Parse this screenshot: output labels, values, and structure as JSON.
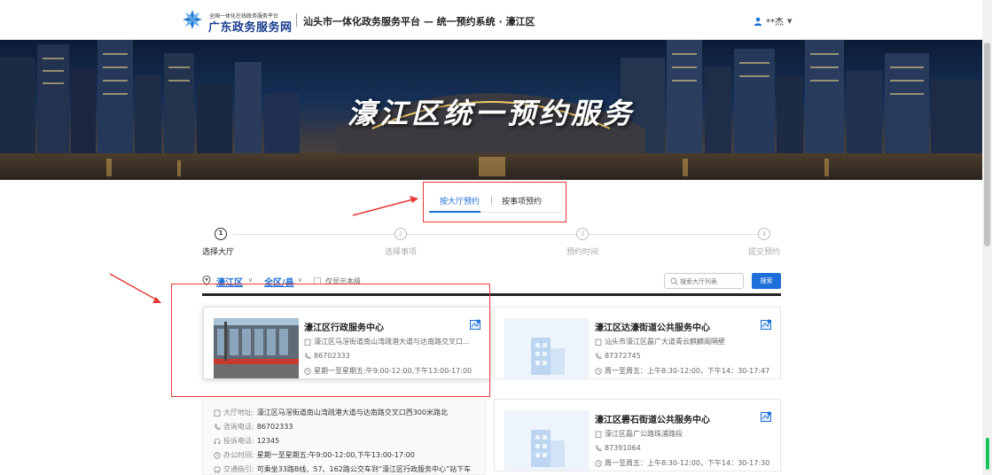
{
  "header": {
    "logo_small": "全国一体化在线政务服务平台",
    "logo_big": "广东政务服务网",
    "title": "汕头市一体化政务服务平台 — 统一预约系统 · 濠江区",
    "user_name": "**杰"
  },
  "banner": {
    "title": "濠江区统一预约服务"
  },
  "tabs": [
    {
      "label": "按大厅预约",
      "active": true
    },
    {
      "label": "按事项预约",
      "active": false
    }
  ],
  "steps": [
    {
      "num": "1",
      "label": "选择大厅",
      "active": true
    },
    {
      "num": "2",
      "label": "选择事项",
      "active": false
    },
    {
      "num": "3",
      "label": "预约时间",
      "active": false
    },
    {
      "num": "4",
      "label": "提交预约",
      "active": false
    }
  ],
  "filter": {
    "region": "濠江区",
    "area": "全区/县",
    "checkbox_label": "仅显示本级",
    "search_placeholder": "搜索大厅列表",
    "search_button": "搜索"
  },
  "halls": [
    {
      "name": "濠江区行政服务中心",
      "address": "濠江区马滘街道南山湾疏港大道与达南路交叉口...",
      "phone": "86702333",
      "hours": "星期一至星期五:午9:00-12:00,下午13:00-17:00",
      "has_photo": true
    },
    {
      "name": "濠江区达濠街道公共服务中心",
      "address": "汕头市濠江区磊广大道青云麒麟阁隔壁",
      "phone": "87372745",
      "hours": "周一至周五：上午8:30-12:00，下午14：30-17:47",
      "has_photo": false
    },
    {
      "name": "濠江区礐石街道公共服务中心",
      "address": "濠江区磊广公路珠浦路段",
      "phone": "87391064",
      "hours": "周一至周五：上午8:30-12:00，下午14：30-17:30",
      "has_photo": false
    }
  ],
  "detail": {
    "address_label": "大厅地址:",
    "address": "濠江区马滘街道南山湾疏港大道与达南路交叉口西300米路北",
    "consult_label": "咨询电话:",
    "consult": "86702333",
    "complaint_label": "投诉电话:",
    "complaint": "12345",
    "hours_label": "办公时间:",
    "hours": "星期一至星期五:午9:00-12:00,下午13:00-17:00",
    "traffic_label": "交通指引:",
    "traffic": "可乘坐33路B线、57、162路公交车到“濠江区行政服务中心”站下车"
  },
  "colors": {
    "accent": "#1e6fd9",
    "highlight": "#e53935",
    "brand": "#1a3d8f"
  }
}
